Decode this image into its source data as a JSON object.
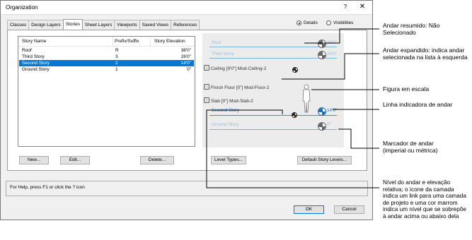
{
  "dialog": {
    "title": "Organization",
    "help_glyph": "?",
    "close_glyph": "✕",
    "tabs": [
      "Classes",
      "Design Layers",
      "Stories",
      "Sheet Layers",
      "Viewports",
      "Saved Views",
      "References"
    ],
    "active_tab": "Stories",
    "view_mode": {
      "details_label": "Details",
      "visibilities_label": "Visibilities",
      "selected": "Details"
    },
    "stories_table": {
      "columns": [
        "Story Name",
        "Prefix/Suffix",
        "Story Elevation"
      ],
      "rows": [
        {
          "name": "Roof",
          "prefix": "R",
          "elevation": "38'0\""
        },
        {
          "name": "Third Story",
          "prefix": "3",
          "elevation": "26'0\""
        },
        {
          "name": "Second Story",
          "prefix": "2",
          "elevation": "14'0\""
        },
        {
          "name": "Ground Story",
          "prefix": "1",
          "elevation": "0\""
        }
      ],
      "selected_row": "Second Story"
    },
    "buttons": {
      "new": "New...",
      "edit": "Edit...",
      "delete": "Delete...",
      "level_types": "Level Types...",
      "default_story_levels": "Default Story Levels...",
      "ok": "OK",
      "cancel": "Cancel"
    },
    "preview": {
      "stories": [
        {
          "name": "Roof",
          "elevation": "38'0\""
        },
        {
          "name": "Third Story",
          "elevation": "26'0\""
        },
        {
          "name": "Second Story",
          "elevation": "14'0\""
        },
        {
          "name": "Ground Story",
          "elevation": "0\""
        }
      ],
      "levels": [
        {
          "label": "Ceiling [9'0\"] Mod-Ceiling-2"
        },
        {
          "label": "Finish Floor [0\"] Mod-Floor-2"
        },
        {
          "label": "Slab [0\"] Mod-Slab-2"
        }
      ]
    },
    "help_text": "For Help, press F1 or click the ? icon"
  },
  "callouts": {
    "collapsed_story": "Andar resumido: Não Selecionado",
    "expanded_story": "Andar expandido: indica andar selecionada na lista à esquerda",
    "scale_figure": "Figura em escala",
    "story_indicator_line": "Linha indicadora de andar",
    "story_marker": "Marcador de andar (imperial ou métrica)",
    "level_and_elevation": "Nível do andar e elevação relativa; o ícone da camada indica um link para uma camada de projeto e uma cor marrom indica um nível que se sobrepõe à andar acima ou abaixo dela"
  },
  "colors": {
    "selection": "#0078d7",
    "story_line": "#7ab4d6",
    "expanded_story_text": "#1f6fb5",
    "collapsed_story_text": "#9cbdd4"
  }
}
